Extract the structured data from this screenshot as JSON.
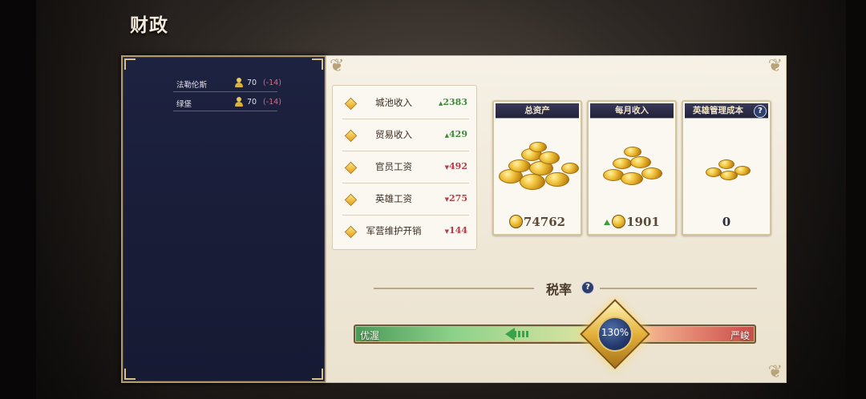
{
  "page_title": "财政",
  "cities": [
    {
      "name": "法勒伦斯",
      "population": "70",
      "delta": "(-14)"
    },
    {
      "name": "绿堡",
      "population": "70",
      "delta": "(-14)"
    }
  ],
  "finance_items": [
    {
      "label": "城池收入",
      "value": "2383",
      "trend": "up"
    },
    {
      "label": "贸易收入",
      "value": "429",
      "trend": "up"
    },
    {
      "label": "官员工资",
      "value": "492",
      "trend": "down"
    },
    {
      "label": "英雄工资",
      "value": "275",
      "trend": "down"
    },
    {
      "label": "军营维护开销",
      "value": "144",
      "trend": "down"
    }
  ],
  "trend_glyphs": {
    "up": "▲",
    "down": "▼"
  },
  "cards": {
    "total_assets": {
      "title": "总资产",
      "value": "74762"
    },
    "monthly_income": {
      "title": "每月收入",
      "value": "1901"
    },
    "hero_cost": {
      "title": "英雄管理成本",
      "value": "0"
    }
  },
  "help_glyph": "?",
  "tax": {
    "title": "税率",
    "rate": "130%",
    "left_label": "优渥",
    "right_label": "严峻"
  },
  "colors": {
    "navy_panel": "#1d2240",
    "cream_panel": "#f6f1e6",
    "gold_border": "#b49a68",
    "income_green": "#3f8c3e",
    "expense_red": "#b53c48"
  }
}
